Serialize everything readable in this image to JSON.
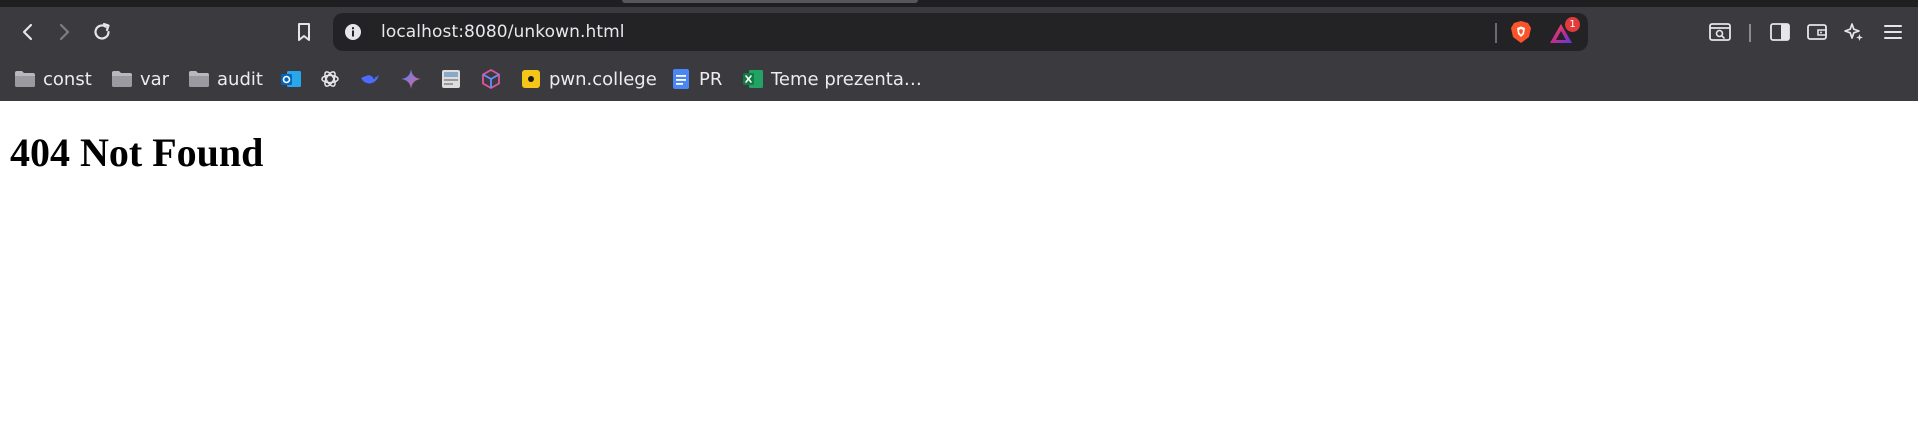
{
  "toolbar": {
    "back_icon": "chevron-left-icon",
    "forward_icon": "chevron-right-icon",
    "reload_icon": "reload-icon",
    "bookmark_icon": "bookmark-icon"
  },
  "omnibox": {
    "url": "localhost:8080/unkown.html",
    "site_info_icon": "info-icon",
    "shield_icon": "brave-shield-icon",
    "rewards_badge": "1"
  },
  "right_toolbar": [
    "tab-search-icon",
    "sidebar-icon",
    "wallet-icon",
    "leo-ai-icon",
    "menu-icon"
  ],
  "bookmarks": [
    {
      "label": "const",
      "icon": "folder-icon"
    },
    {
      "label": "var",
      "icon": "folder-icon"
    },
    {
      "label": "audit",
      "icon": "folder-icon"
    },
    {
      "label": "",
      "icon": "outlook-icon"
    },
    {
      "label": "",
      "icon": "chatgpt-icon"
    },
    {
      "label": "",
      "icon": "deepseek-icon"
    },
    {
      "label": "",
      "icon": "gemini-icon"
    },
    {
      "label": "",
      "icon": "site-icon"
    },
    {
      "label": "",
      "icon": "cube-icon"
    },
    {
      "label": "pwn.college",
      "icon": "pwn-college-icon"
    },
    {
      "label": "PR",
      "icon": "google-docs-icon"
    },
    {
      "label": "Teme prezenta…",
      "icon": "excel-icon"
    }
  ],
  "colors": {
    "chrome_bg": "#3b3b3f",
    "omnibox_bg": "#232326",
    "shield_orange": "#fb542b",
    "badge_red": "#e23b3b"
  },
  "page": {
    "heading": "404 Not Found"
  }
}
